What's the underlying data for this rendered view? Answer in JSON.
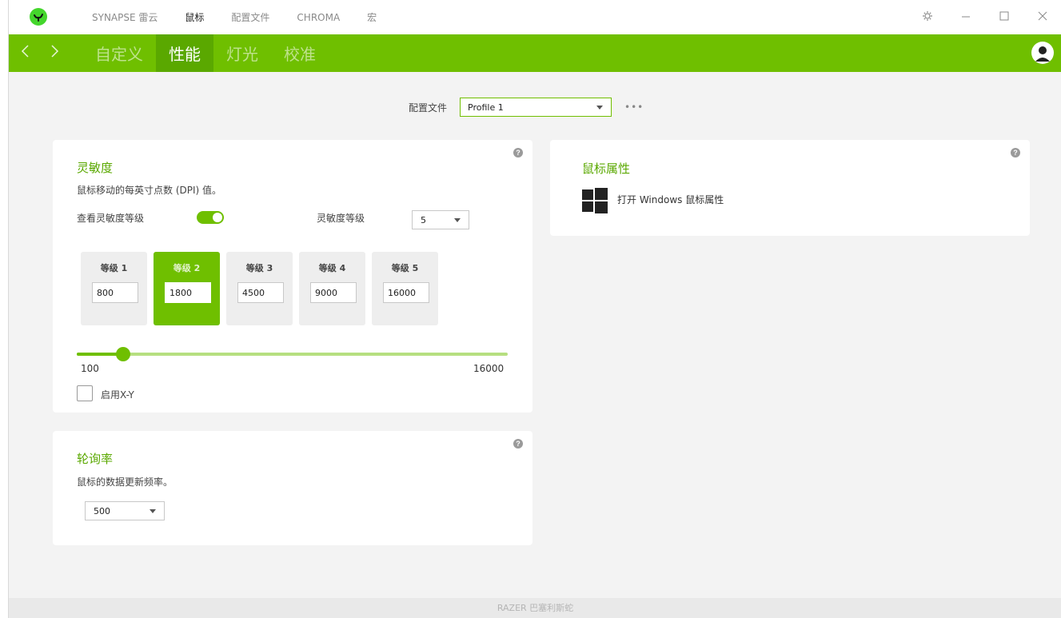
{
  "titlebar": {
    "nav": [
      "SYNAPSE 雷云",
      "鼠标",
      "配置文件",
      "CHROMA",
      "宏"
    ],
    "active_index": 1
  },
  "subnav": {
    "tabs": [
      "自定义",
      "性能",
      "灯光",
      "校准"
    ],
    "active_index": 1
  },
  "profile": {
    "label": "配置文件",
    "value": "Profile 1",
    "more": "•••"
  },
  "sensitivity": {
    "title": "灵敏度",
    "description": "鼠标移动的每英寸点数 (DPI) 值。",
    "view_levels_label": "查看灵敏度等级",
    "view_levels_on": true,
    "levels_label": "灵敏度等级",
    "levels_count": "5",
    "levels": [
      {
        "label": "等级 1",
        "value": "800"
      },
      {
        "label": "等级 2",
        "value": "1800"
      },
      {
        "label": "等级 3",
        "value": "4500"
      },
      {
        "label": "等级 4",
        "value": "9000"
      },
      {
        "label": "等级 5",
        "value": "16000"
      }
    ],
    "active_level_index": 1,
    "slider": {
      "min": "100",
      "max": "16000",
      "current": 1800
    },
    "xy_label": "启用X-Y",
    "xy_checked": false
  },
  "polling": {
    "title": "轮询率",
    "description": "鼠标的数据更新频率。",
    "value": "500"
  },
  "mouse_props": {
    "title": "鼠标属性",
    "link": "打开 Windows 鼠标属性"
  },
  "footer": {
    "text": "RAZER 巴塞利斯蛇"
  },
  "colors": {
    "accent": "#6fbf00",
    "accent_dark": "#5aa800",
    "razer_green": "#44d62c"
  }
}
